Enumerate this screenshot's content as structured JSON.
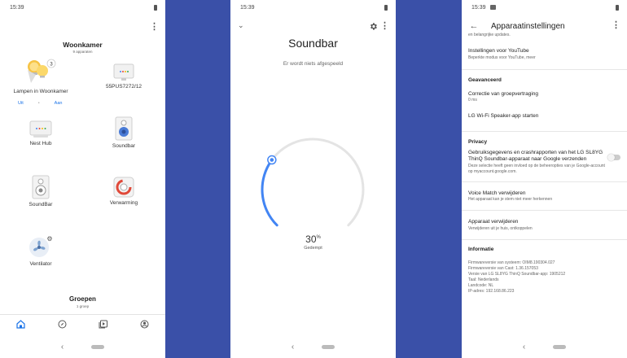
{
  "home_screen": {
    "status_time": "15:39",
    "home_name": "Woonkamer",
    "device_count_label": "9 apparaten",
    "devices": {
      "lamps": {
        "name": "Lampen in Woonkamer",
        "badge": "3",
        "off_label": "Uit",
        "on_label": "Aan"
      },
      "tv": {
        "name": "55PUS7272/12"
      },
      "nest_hub": {
        "name": "Nest Hub"
      },
      "soundbar": {
        "name": "Soundbar"
      },
      "soundbar2": {
        "name": "SoundBar"
      },
      "heating": {
        "name": "Verwarming"
      },
      "fan": {
        "name": "Ventilator"
      }
    },
    "groups_title": "Groepen",
    "groups_count": "1 groep",
    "tabs": [
      "home-icon",
      "compass-icon",
      "media-icon",
      "account-icon"
    ],
    "accent_color": "#1a73e8"
  },
  "soundbar_screen": {
    "status_time": "15:39",
    "title": "Soundbar",
    "playback_status": "Er wordt niets afgespeeld",
    "volume_value": "30",
    "volume_unit": "%",
    "volume_fraction": 0.3,
    "volume_state": "Gedempt",
    "arc_color": "#4285f4"
  },
  "settings_screen": {
    "status_time": "15:39",
    "title": "Apparaatinstellingen",
    "clipped_top": "en belangrijke updates.",
    "youtube_title": "Instellingen voor YouTube",
    "youtube_sub": "Beperkte modus voor YouTube, meer",
    "advanced_header": "Geavanceerd",
    "delay_title": "Correctie van groepvertraging",
    "delay_value": "0 ms",
    "lg_app_title": "LG Wi-Fi Speaker-app starten",
    "privacy_header": "Privacy",
    "privacy_title": "Gebruiksgegevens en crashrapporten van het LG SL8YG ThinQ Soundbar-apparaat naar Google verzenden",
    "privacy_sub": "Deze selectie heeft geen invloed op de beheeropties van je Google-account op myaccount.google.com.",
    "voice_match_title": "Voice Match verwijderen",
    "voice_match_sub": "Het apparaat kan je stem niet meer herkennen",
    "remove_title": "Apparaat verwijderen",
    "remove_sub": "Verwijderen uit je huis, ontkoppelen",
    "info_header": "Informatie",
    "info_lines": [
      "Firmwareversie van systeem: OIM8.190304.027",
      "Firmwareversie van Cast: 1.36.157053",
      "Versie van LG SL8YG ThinQ Soundbar-app: 1905212",
      "Taal: Nederlands",
      "Landcode: NL",
      "IP-adres: 192.168.86.223"
    ]
  }
}
